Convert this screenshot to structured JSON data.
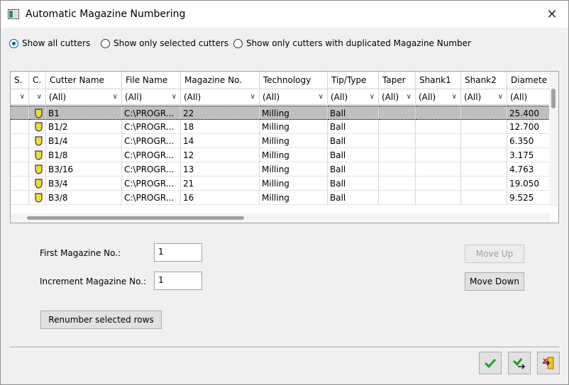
{
  "window": {
    "title": "Automatic Magazine Numbering",
    "close_glyph": "✕"
  },
  "filters": {
    "options": [
      {
        "label": "Show all cutters",
        "checked": true
      },
      {
        "label": "Show only selected cutters",
        "checked": false
      },
      {
        "label": "Show only cutters with duplicated Magazine Number",
        "checked": false
      }
    ]
  },
  "table": {
    "columns": [
      "S.",
      "C.",
      "Cutter Name",
      "File Name",
      "Magazine No.",
      "Technology",
      "Tip/Type",
      "Taper",
      "Shank1",
      "Shank2",
      "Diamete"
    ],
    "filter_value": "(All)",
    "rows": [
      {
        "name": "B1",
        "file": "C:\\PROGR...",
        "mag": "22",
        "tech": "Milling",
        "tip": "Ball",
        "dia": "25.400",
        "selected": true
      },
      {
        "name": "B1/2",
        "file": "C:\\PROGR...",
        "mag": "18",
        "tech": "Milling",
        "tip": "Ball",
        "dia": "12.700",
        "selected": false
      },
      {
        "name": "B1/4",
        "file": "C:\\PROGR...",
        "mag": "14",
        "tech": "Milling",
        "tip": "Ball",
        "dia": "6.350",
        "selected": false
      },
      {
        "name": "B1/8",
        "file": "C:\\PROGR...",
        "mag": "12",
        "tech": "Milling",
        "tip": "Ball",
        "dia": "3.175",
        "selected": false
      },
      {
        "name": "B3/16",
        "file": "C:\\PROGR...",
        "mag": "13",
        "tech": "Milling",
        "tip": "Ball",
        "dia": "4.763",
        "selected": false
      },
      {
        "name": "B3/4",
        "file": "C:\\PROGR...",
        "mag": "21",
        "tech": "Milling",
        "tip": "Ball",
        "dia": "19.050",
        "selected": false
      },
      {
        "name": "B3/8",
        "file": "C:\\PROGR...",
        "mag": "16",
        "tech": "Milling",
        "tip": "Ball",
        "dia": "9.525",
        "selected": false
      }
    ]
  },
  "form": {
    "first_label": "First Magazine No.:",
    "first_value": "1",
    "increment_label": "Increment Magazine No.:",
    "increment_value": "1",
    "renumber_label": "Renumber selected rows",
    "move_up_label": "Move Up",
    "move_down_label": "Move Down"
  },
  "footer": {
    "ok_icon": "check-icon",
    "apply_icon": "check-arrow-icon",
    "cancel_icon": "exit-icon"
  },
  "colors": {
    "accent": "#0060c0",
    "selected_row": "#bfbfbf",
    "ok_green": "#1ea01e",
    "tool_yellow": "#f0e020"
  }
}
